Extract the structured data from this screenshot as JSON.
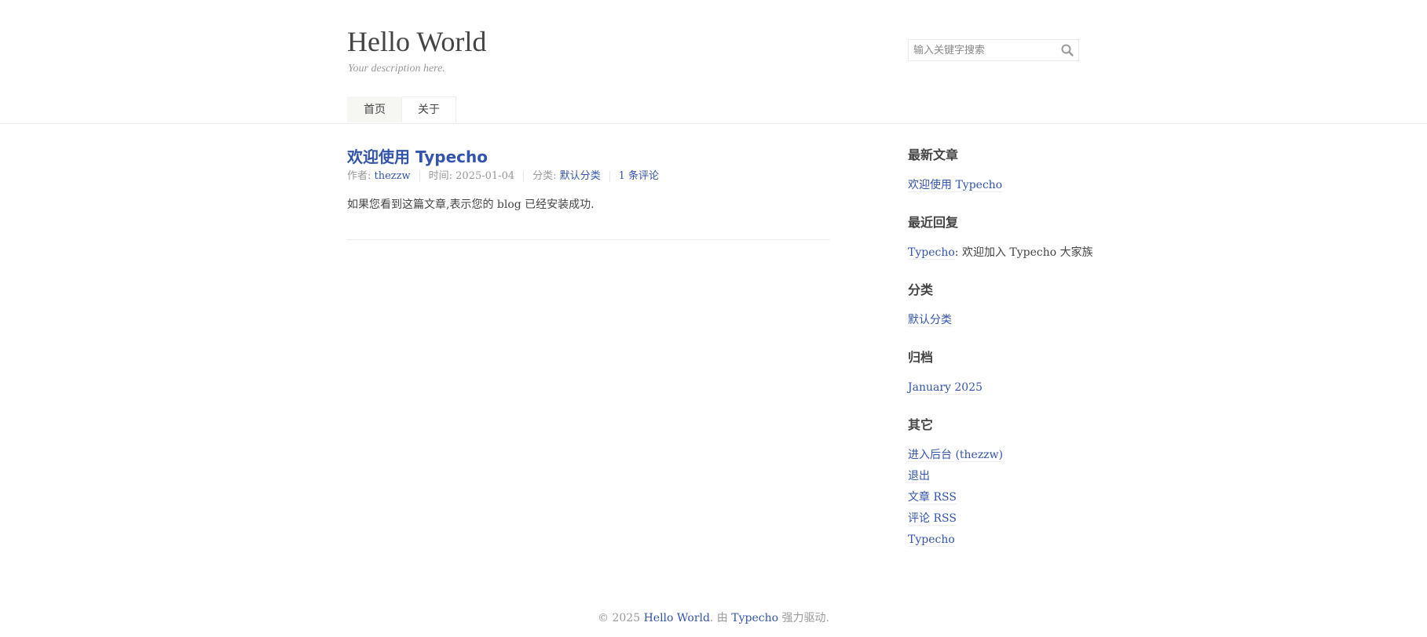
{
  "site": {
    "title": "Hello World",
    "description": "Your description here."
  },
  "search": {
    "placeholder": "输入关键字搜索",
    "value": "",
    "icon": "search-icon"
  },
  "nav": {
    "items": [
      {
        "label": "首页",
        "current": true
      },
      {
        "label": "关于",
        "current": false
      }
    ]
  },
  "post": {
    "title": "欢迎使用 Typecho",
    "meta": {
      "author_label": "作者: ",
      "author": "thezzw",
      "time_label": "时间: ",
      "time": "2025-01-04",
      "category_label": "分类: ",
      "category": "默认分类",
      "comments": "1 条评论"
    },
    "content": "如果您看到这篇文章,表示您的 blog 已经安装成功."
  },
  "sidebar": {
    "recent_posts": {
      "title": "最新文章",
      "items": [
        "欢迎使用 Typecho"
      ]
    },
    "recent_comments": {
      "title": "最近回复",
      "items": [
        {
          "author": "Typecho",
          "text": ": 欢迎加入 Typecho 大家族"
        }
      ]
    },
    "categories": {
      "title": "分类",
      "items": [
        "默认分类"
      ]
    },
    "archives": {
      "title": "归档",
      "items": [
        "January 2025"
      ]
    },
    "other": {
      "title": "其它",
      "items": [
        "进入后台 (thezzw)",
        "退出",
        "文章 RSS",
        "评论 RSS",
        "Typecho"
      ]
    }
  },
  "footer": {
    "copyright": "© 2025 ",
    "site_link": "Hello World",
    "by": ". 由 ",
    "engine_link": "Typecho",
    "powered": " 强力驱动."
  },
  "colors": {
    "link": "#3354AA",
    "text": "#444444",
    "muted": "#999999",
    "border": "#eeeeee"
  }
}
